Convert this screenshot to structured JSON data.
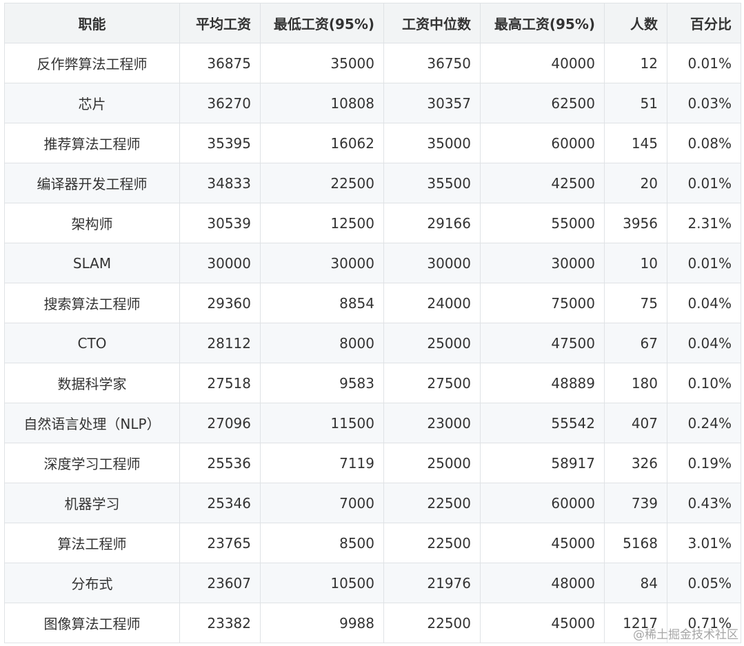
{
  "table": {
    "headers": [
      "职能",
      "平均工资",
      "最低工资(95%)",
      "工资中位数",
      "最高工资(95%)",
      "人数",
      "百分比"
    ],
    "rows": [
      [
        "反作弊算法工程师",
        "36875",
        "35000",
        "36750",
        "40000",
        "12",
        "0.01%"
      ],
      [
        "芯片",
        "36270",
        "10808",
        "30357",
        "62500",
        "51",
        "0.03%"
      ],
      [
        "推荐算法工程师",
        "35395",
        "16062",
        "35000",
        "60000",
        "145",
        "0.08%"
      ],
      [
        "编译器开发工程师",
        "34833",
        "22500",
        "35500",
        "42500",
        "20",
        "0.01%"
      ],
      [
        "架构师",
        "30539",
        "12500",
        "29166",
        "55000",
        "3956",
        "2.31%"
      ],
      [
        "SLAM",
        "30000",
        "30000",
        "30000",
        "30000",
        "10",
        "0.01%"
      ],
      [
        "搜索算法工程师",
        "29360",
        "8854",
        "24000",
        "75000",
        "75",
        "0.04%"
      ],
      [
        "CTO",
        "28112",
        "8000",
        "25000",
        "47500",
        "67",
        "0.04%"
      ],
      [
        "数据科学家",
        "27518",
        "9583",
        "27500",
        "48889",
        "180",
        "0.10%"
      ],
      [
        "自然语言处理（NLP）",
        "27096",
        "11500",
        "23000",
        "55542",
        "407",
        "0.24%"
      ],
      [
        "深度学习工程师",
        "25536",
        "7119",
        "25000",
        "58917",
        "326",
        "0.19%"
      ],
      [
        "机器学习",
        "25346",
        "7000",
        "22500",
        "60000",
        "739",
        "0.43%"
      ],
      [
        "算法工程师",
        "23765",
        "8500",
        "22500",
        "45000",
        "5168",
        "3.01%"
      ],
      [
        "分布式",
        "23607",
        "10500",
        "21976",
        "48000",
        "84",
        "0.05%"
      ],
      [
        "图像算法工程师",
        "23382",
        "9988",
        "22500",
        "45000",
        "1217",
        "0.71%"
      ]
    ]
  },
  "watermark": "@稀土掘金技术社区"
}
